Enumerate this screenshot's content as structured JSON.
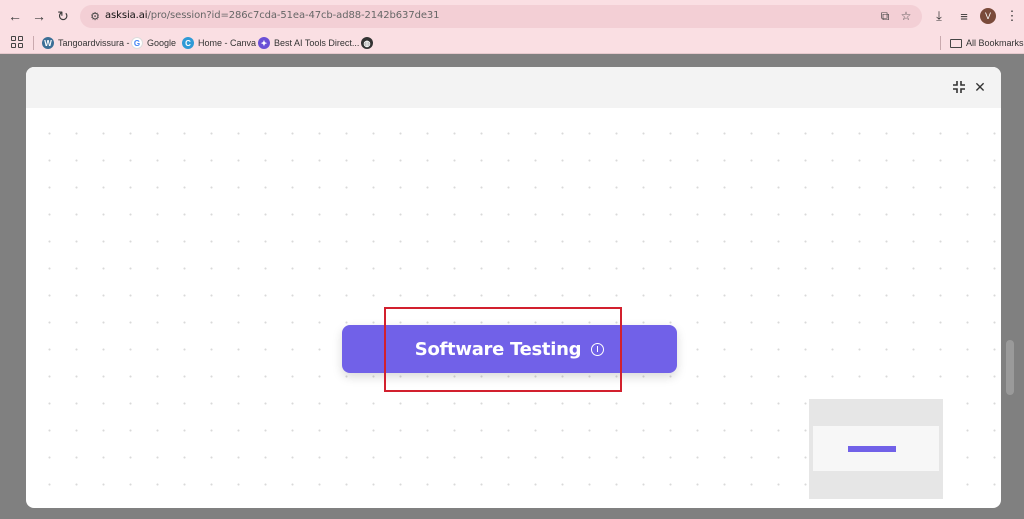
{
  "browser": {
    "url_host": "asksia.ai",
    "url_path": "/pro/session?id=286c7cda-51ea-47cb-ad88-2142b637de31",
    "avatar_letter": "V"
  },
  "bookmarks": {
    "items": [
      {
        "label": "Tangoardvissura -",
        "icon": "wordpress-icon"
      },
      {
        "label": "Google",
        "icon": "google-icon"
      },
      {
        "label": "Home - Canva",
        "icon": "canva-icon"
      },
      {
        "label": "Best AI Tools Direct...",
        "icon": "ai-tools-icon"
      },
      {
        "label": "",
        "icon": "globe-icon"
      }
    ],
    "all_bookmarks_label": "All Bookmarks"
  },
  "modal": {
    "node_label": "Software Testing"
  },
  "colors": {
    "accent": "#7161e8",
    "highlight": "#d2202e",
    "chrome": "#fadfe3"
  }
}
